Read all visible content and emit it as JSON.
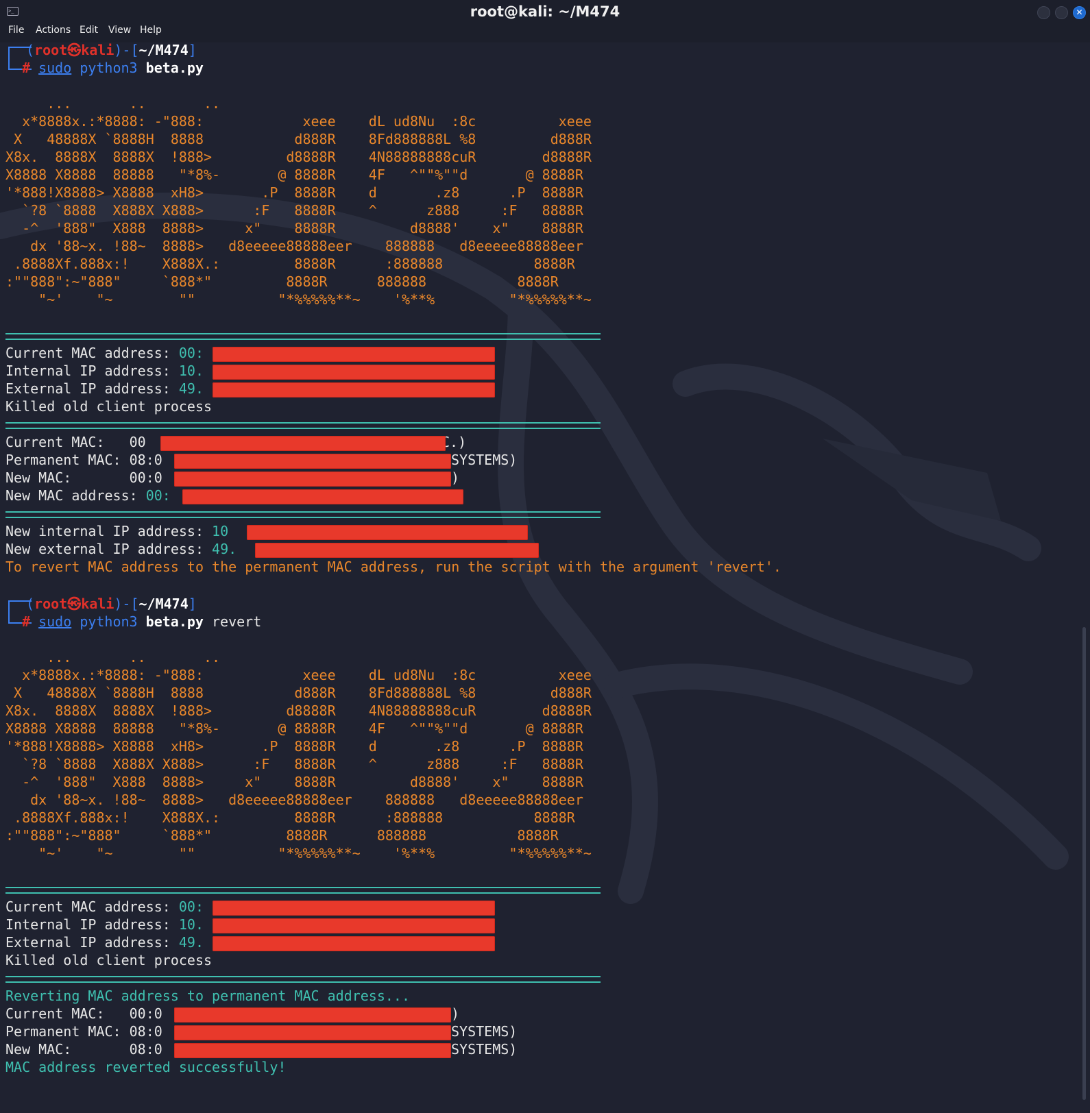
{
  "window": {
    "title": "root@kali: ~/M474"
  },
  "menu": {
    "file": "File",
    "actions": "Actions",
    "edit": "Edit",
    "view": "View",
    "help": "Help"
  },
  "prompt": {
    "dash_open": "(",
    "user": "root",
    "at_symbol": "㉿",
    "host": "kali",
    "close_bracket": ")-[",
    "path": "~/M474",
    "path_close": "]",
    "hash": "#",
    "sudo": "sudo",
    "python": "python3",
    "script": "beta.py"
  },
  "commands": {
    "first_arg": "",
    "second_arg": "revert"
  },
  "ascii_art": [
    "     ...       ..       ..",
    "  x*8888x.:*8888: -\"888:            xeee    dL ud8Nu  :8c          xeee",
    " X   48888X `8888H  8888           d888R    8Fd888888L %8         d888R",
    "X8x.  8888X  8888X  !888>         d8888R    4N88888888cuR        d8888R",
    "X8888 X8888  88888   \"*8%-       @ 8888R    4F   ^\"\"%\"\"d       @ 8888R",
    "'*888!X8888> X8888  xH8>       .P  8888R    d       .z8      .P  8888R",
    "  `?8 `8888  X888X X888>      :F   8888R    ^      z888     :F   8888R",
    "  -^  '888\"  X888  8888>     x\"    8888R         d8888'    x\"    8888R",
    "   dx '88~x. !88~  8888>   d8eeeee88888eer    888888   d8eeeee88888eer",
    " .8888Xf.888x:!    X888X.:         8888R      :888888           8888R",
    ":\"\"888\":~\"888\"     `888*\"         8888R      888888           8888R",
    "    \"~'    \"~        \"\"          \"*%%%%%**~    '%**%         \"*%%%%%**~"
  ],
  "run1": {
    "current_mac_label": "Current MAC address: ",
    "current_mac_value": "00:",
    "internal_ip_label": "Internal IP address: ",
    "internal_ip_value": "10.",
    "external_ip_label": "External IP address: ",
    "external_ip_value": "49.",
    "killed": "Killed old client process",
    "mc_current_label": "Current MAC:   ",
    "mc_current_value": "00",
    "mc_current_tail": "C.)",
    "mc_permanent_label": "Permanent MAC: ",
    "mc_permanent_value": "08:0",
    "mc_permanent_tail": "SYSTEMS)",
    "mc_new_label": "New MAC:       ",
    "mc_new_value": "00:0",
    "mc_new_tail": ")",
    "new_mac_label": "New MAC address: ",
    "new_mac_value": "00:",
    "new_internal_label": "New internal IP address: ",
    "new_internal_value": "10",
    "new_external_label": "New external IP address: ",
    "new_external_value": "49.",
    "revert_hint": "To revert MAC address to the permanent MAC address, run the script with the argument 'revert'."
  },
  "run2": {
    "current_mac_label": "Current MAC address: ",
    "current_mac_value": "00:",
    "internal_ip_label": "Internal IP address: ",
    "internal_ip_value": "10.",
    "external_ip_label": "External IP address: ",
    "external_ip_value": "49.",
    "killed": "Killed old client process",
    "reverting": "Reverting MAC address to permanent MAC address...",
    "mc_current_label": "Current MAC:   ",
    "mc_current_value": "00:0",
    "mc_current_tail": ")",
    "mc_permanent_label": "Permanent MAC: ",
    "mc_permanent_value": "08:0",
    "mc_permanent_tail": "SYSTEMS)",
    "mc_new_label": "New MAC:       ",
    "mc_new_value": "08:0",
    "mc_new_tail": "SYSTEMS)",
    "success": "MAC address reverted successfully!"
  },
  "colors": {
    "background": "#1f2230",
    "prompt_blue": "#3c7ff0",
    "prompt_red": "#e0312a",
    "cyan": "#3fc0b0",
    "orange": "#e9872b",
    "redaction": "#e8392b"
  }
}
